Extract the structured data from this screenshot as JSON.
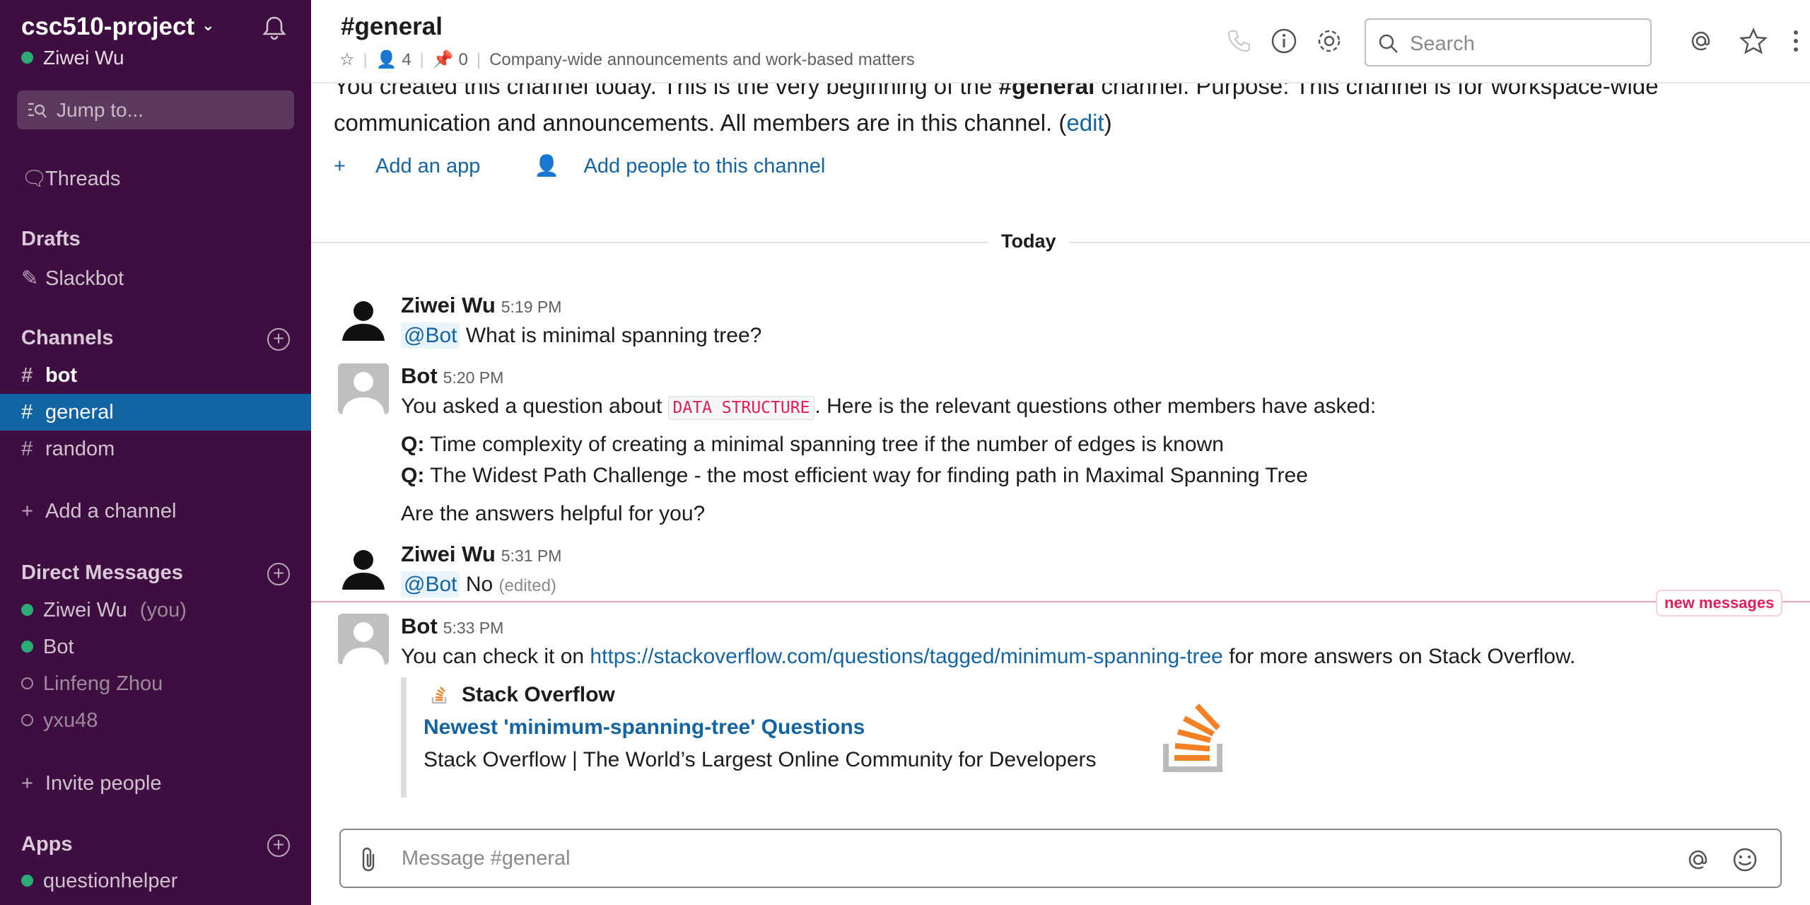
{
  "workspace": {
    "name": "csc510-project",
    "user": "Ziwei Wu"
  },
  "sidebar": {
    "jump_placeholder": "Jump to...",
    "threads": "Threads",
    "drafts_heading": "Drafts",
    "drafts": [
      "Slackbot"
    ],
    "channels_heading": "Channels",
    "channels": [
      {
        "name": "bot",
        "unread": true
      },
      {
        "name": "general",
        "active": true
      },
      {
        "name": "random"
      }
    ],
    "add_channel": "Add a channel",
    "dm_heading": "Direct Messages",
    "dms": [
      {
        "name": "Ziwei Wu",
        "suffix": "(you)",
        "online": true
      },
      {
        "name": "Bot",
        "online": true
      },
      {
        "name": "Linfeng Zhou",
        "online": false
      },
      {
        "name": "yxu48",
        "online": false
      }
    ],
    "invite": "Invite people",
    "apps_heading": "Apps",
    "apps": [
      {
        "name": "questionhelper",
        "online": true
      }
    ]
  },
  "header": {
    "channel": "#general",
    "members": "4",
    "pins": "0",
    "purpose": "Company-wide announcements and work-based matters",
    "search_placeholder": "Search"
  },
  "intro": {
    "text_1": "You created this channel today. This is the very beginning of the ",
    "channel_bold": "#general",
    "text_2": " channel. Purpose: This channel is for workspace-wide communication and announcements. All members are in this channel. (",
    "edit_link": "edit",
    "text_3": ")",
    "add_app": "Add an app",
    "add_people": "Add people to this channel"
  },
  "divider_label": "Today",
  "messages": [
    {
      "author": "Ziwei Wu",
      "time": "5:19 PM",
      "mention": "@Bot",
      "text": "What is minimal spanning tree?"
    },
    {
      "author": "Bot",
      "time": "5:20 PM",
      "text_before": "You asked a question about ",
      "code": "DATA STRUCTURE",
      "text_after": ". Here is the relevant questions other members have asked:",
      "q_prefix": "Q:",
      "questions": [
        "Time complexity of creating a minimal spanning tree if the number of edges is known",
        "The Widest Path Challenge - the most efficient way for finding path in Maximal Spanning Tree"
      ],
      "followup": "Are the answers helpful for you?"
    },
    {
      "author": "Ziwei Wu",
      "time": "5:31 PM",
      "mention": "@Bot",
      "text": "No",
      "edited": "(edited)"
    },
    {
      "author": "Bot",
      "time": "5:33 PM",
      "text_before": "You can check it on ",
      "link": "https://stackoverflow.com/questions/tagged/minimum-spanning-tree",
      "text_after": " for more answers on Stack Overflow.",
      "unfurl": {
        "source": "Stack Overflow",
        "title": "Newest 'minimum-spanning-tree' Questions",
        "description": "Stack Overflow | The World’s Largest Online Community for Developers"
      }
    }
  ],
  "new_messages_label": "new messages",
  "composer": {
    "placeholder": "Message #general"
  },
  "colors": {
    "sidebar": "#3f0e40",
    "active": "#1164a3",
    "link": "#1264a3",
    "presence": "#2bac76",
    "new_messages": "#e01e5a"
  }
}
